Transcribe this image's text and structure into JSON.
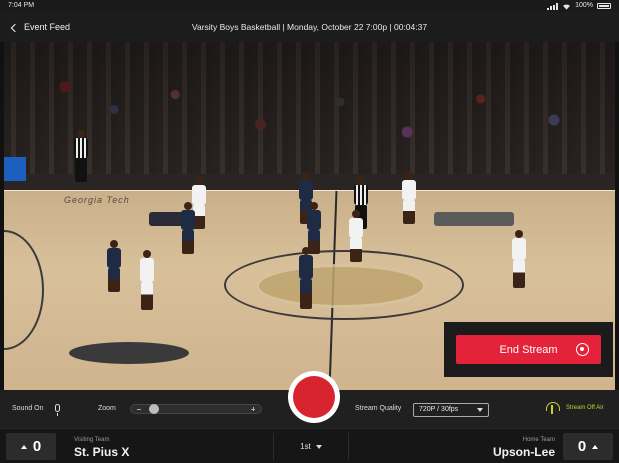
{
  "status_bar": {
    "time": "7:04 PM",
    "battery": "100%"
  },
  "nav": {
    "back_label": "Event Feed",
    "title": "Varsity Boys Basketball | Monday, October 22 7:00p | 00:04:37"
  },
  "video": {
    "end_stream_label": "End Stream",
    "court_text": "Georgia Tech"
  },
  "controls": {
    "sound_label": "Sound On",
    "zoom_label": "Zoom",
    "zoom_level": 0.1,
    "quality_label": "Stream Quality",
    "quality_value": "720P / 30fps",
    "stream_status": "Stream Off Air"
  },
  "score": {
    "visiting_caption": "Visiting Team",
    "visiting_name": "St. Pius X",
    "visiting_score": "0",
    "period": "1st",
    "home_caption": "Home Team",
    "home_name": "Upson-Lee",
    "home_score": "0"
  },
  "colors": {
    "record": "#d8242f",
    "end_stream": "#e4233b",
    "status_accent": "#c8d12a"
  }
}
